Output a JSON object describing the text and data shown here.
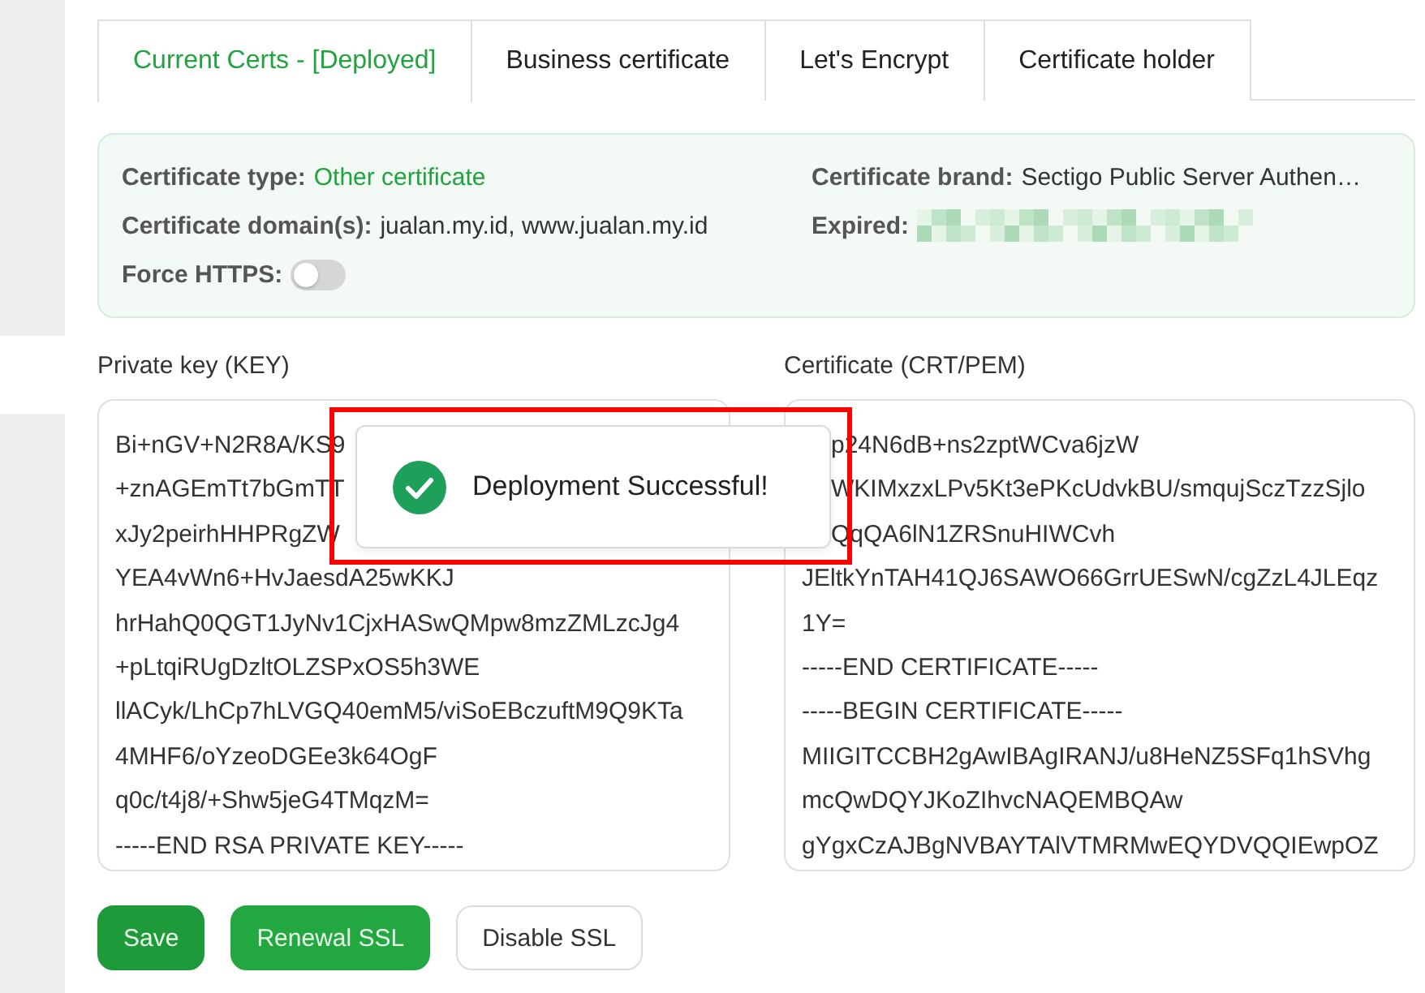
{
  "tabs": [
    {
      "label": "Current Certs - [Deployed]",
      "selected": true
    },
    {
      "label": "Business certificate",
      "selected": false
    },
    {
      "label": "Let's Encrypt",
      "selected": false
    },
    {
      "label": "Certificate holder",
      "selected": false
    }
  ],
  "certificate_info": {
    "fields": [
      {
        "kind": "status",
        "label": "Certificate type:",
        "value": "Other certificate"
      },
      {
        "kind": "text",
        "label": "Certificate brand:",
        "value": "Sectigo Public Server Authen…"
      },
      {
        "kind": "text",
        "label": "Certificate domain(s):",
        "value": "jualan.my.id, www.jualan.my.id"
      },
      {
        "kind": "redacted",
        "label": "Expired:"
      },
      {
        "kind": "toggle",
        "label": "Force HTTPS:",
        "on": false
      }
    ]
  },
  "private_key": {
    "label": "Private key (KEY)",
    "lines": [
      {
        "text": "Bi+nGV+N2R8A/KS9"
      },
      {
        "text": "+znAGEmTt7bGmTT"
      },
      {
        "text": "xJy2peirhHHPRgZW"
      },
      {
        "text": "YEA4vWn6+HvJaesdA25wKKJ"
      },
      {
        "text": "hrHahQ0QGT1JyNv1CjxHASwQMpw8mzZMLzcJg4"
      },
      {
        "text": "+pLtqiRUgDzltOLZSPxOS5h3WE"
      },
      {
        "text": "llACyk/LhCp7hLVGQ40emM5/viSoEBczuftM9Q9KTa"
      },
      {
        "text": "4MHF6/oYzeoDGEe3k64OgF"
      },
      {
        "text": "q0c/t4j8/+Shw5jeG4TMqzM="
      },
      {
        "text": "-----END RSA PRIVATE KEY-----"
      }
    ]
  },
  "certificate": {
    "label": "Certificate (CRT/PEM)",
    "lines": [
      {
        "text": "p24N6dB+ns2zptWCva6jzW",
        "covered_start": true
      },
      {
        "text": "WKIMxzxLPv5Kt3ePKcUdvkBU/smqujSczTzzSjlo",
        "covered_start": true
      },
      {
        "text": "QqQA6lN1ZRSnuHIWCvh",
        "covered_start": true
      },
      {
        "text": "JEltkYnTAH41QJ6SAWO66GrrUESwN/cgZzL4JLEqz"
      },
      {
        "text": "1Y="
      },
      {
        "text": "-----END CERTIFICATE-----"
      },
      {
        "text": "-----BEGIN CERTIFICATE-----"
      },
      {
        "text": "MIIGITCCBH2gAwIBAgIRANJ/u8HeNZ5SFq1hSVhg"
      },
      {
        "text": "mcQwDQYJKoZIhvcNAQEMBQAw"
      },
      {
        "text": "gYgxCzAJBgNVBAYTAlVTMRMwEQYDVQQIEwpOZ"
      }
    ]
  },
  "buttons": [
    {
      "label": "Save",
      "kind": "primary"
    },
    {
      "label": "Renewal SSL",
      "kind": "success"
    },
    {
      "label": "Disable SSL",
      "kind": "outline"
    }
  ],
  "toast": {
    "kind": "success",
    "message": "Deployment Successful!"
  }
}
